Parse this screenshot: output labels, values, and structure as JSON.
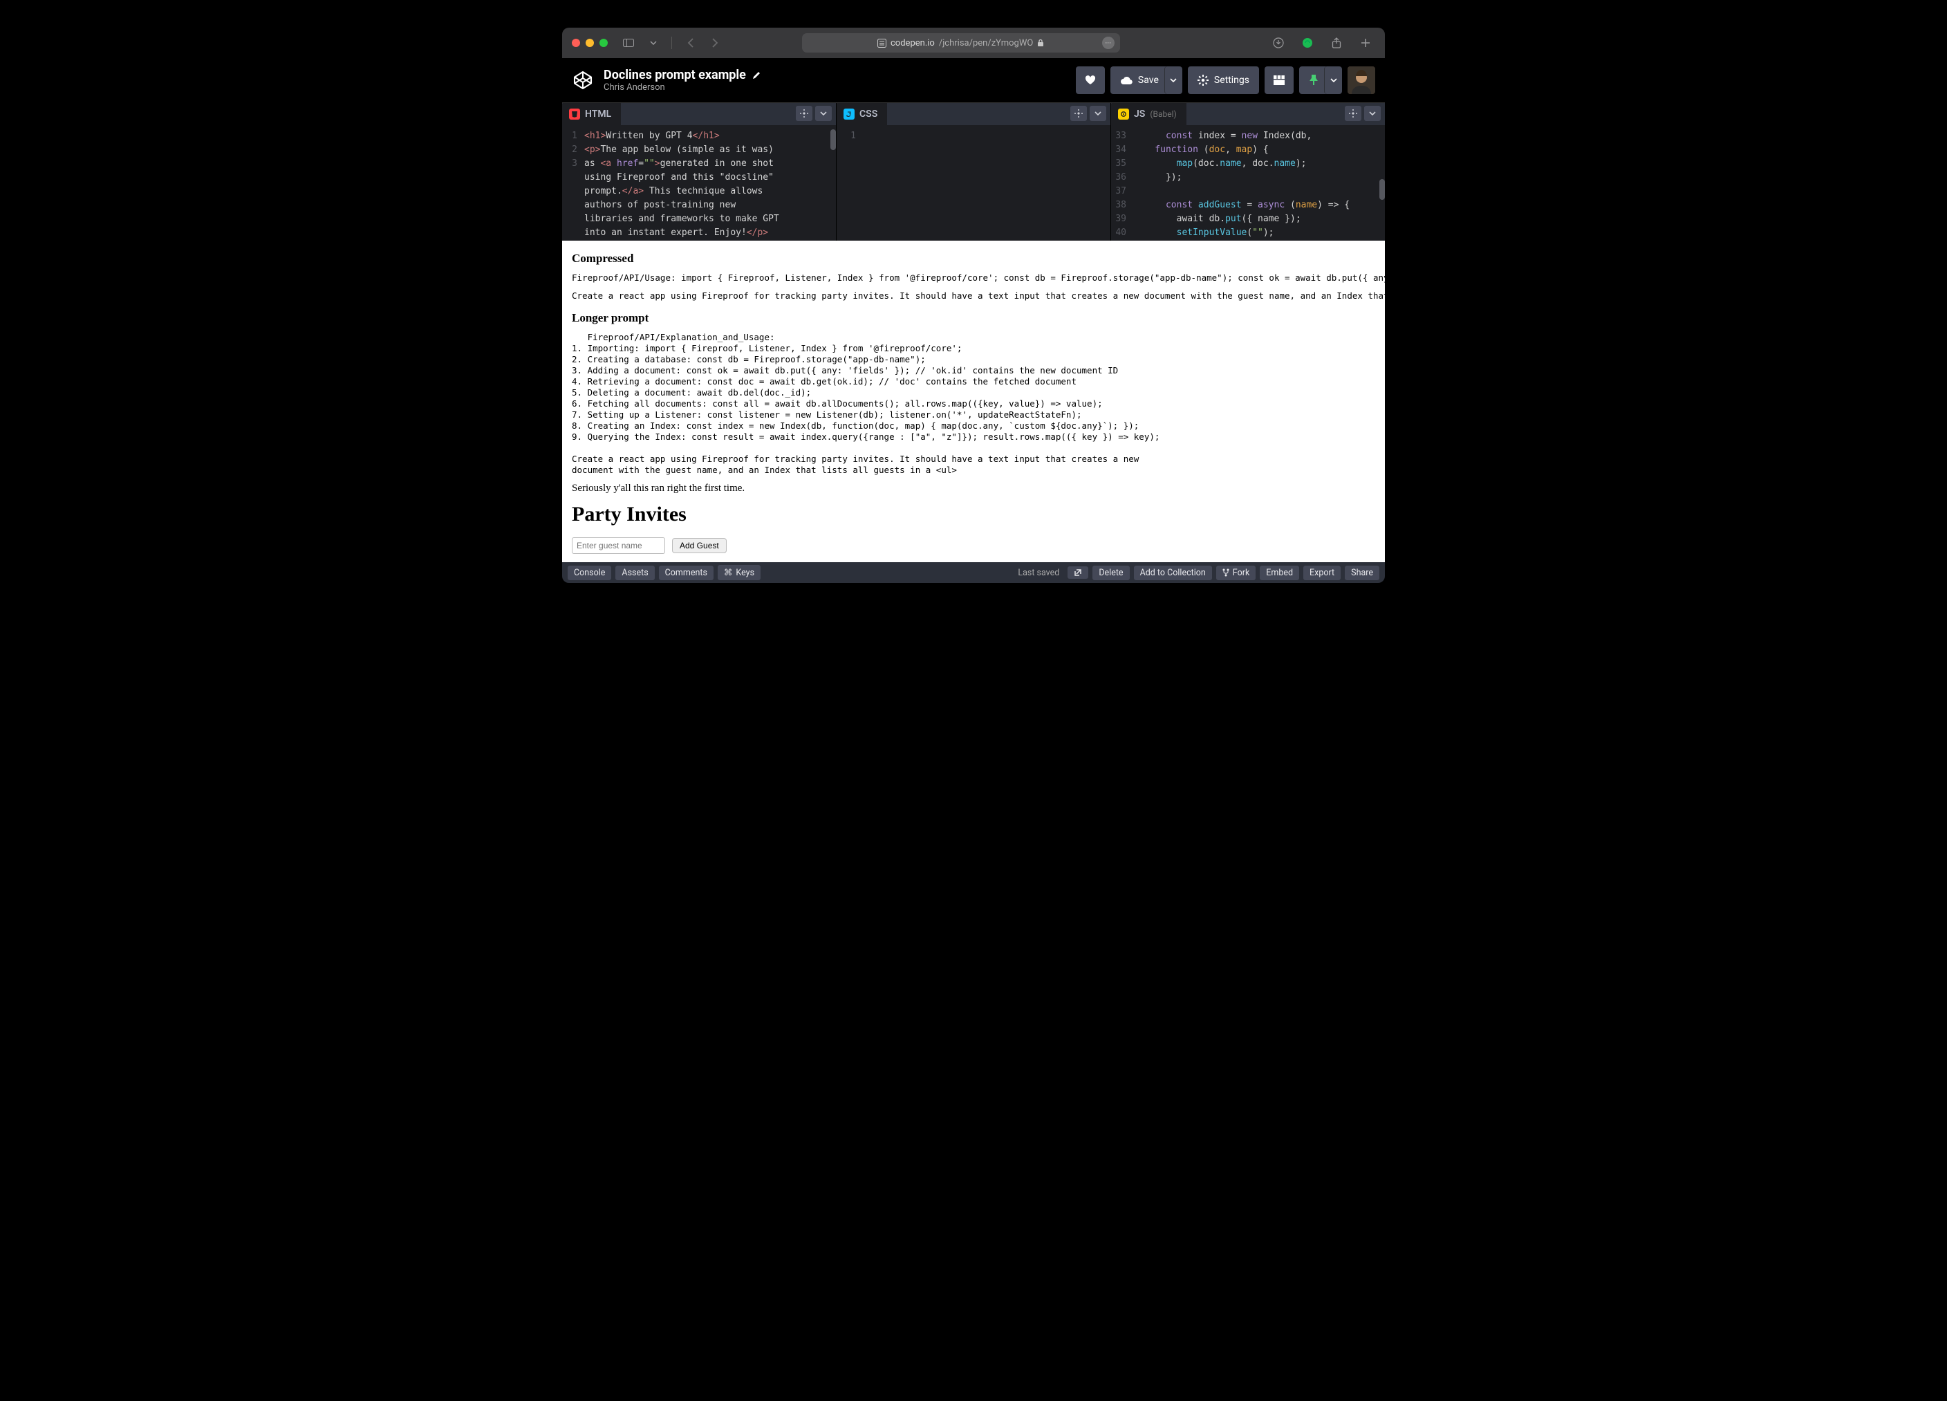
{
  "browser": {
    "url_host": "codepen.io",
    "url_path": "/jchrisa/pen/zYmogWO"
  },
  "header": {
    "title": "Doclines prompt example",
    "author": "Chris Anderson",
    "save_label": "Save",
    "settings_label": "Settings"
  },
  "panels": {
    "html": {
      "label": "HTML"
    },
    "css": {
      "label": "CSS"
    },
    "js": {
      "label": "JS",
      "sublabel": "(Babel)"
    }
  },
  "html_code": {
    "lines": [
      "1",
      "2",
      "",
      "",
      "",
      "",
      "",
      "",
      "3"
    ],
    "l1_open": "<h1>",
    "l1_text": "Written by GPT 4",
    "l1_close": "</h1>",
    "l2_open": "<p>",
    "l2a": "The app below (simple as it was)",
    "l2b_pre": "as ",
    "l2b_aopen": "<a ",
    "l2b_attr": "href",
    "l2b_eq": "=",
    "l2b_val": "\"\"",
    "l2b_aclose": ">",
    "l2b_text": "generated in one shot",
    "l2c": "using Fireproof and this \"docsline\"",
    "l2d_pre": "prompt.",
    "l2d_aclose": "</a>",
    "l2d_text": " This technique allows",
    "l2e": "authors of post-training new",
    "l2f": "libraries and frameworks to make GPT",
    "l2g_text": "into an instant expert. Enjoy!",
    "l2g_close": "</p>"
  },
  "css_code": {
    "line1": "1"
  },
  "js_code": {
    "lines": [
      "33",
      "34",
      "35",
      "36",
      "37",
      "38",
      "39",
      "40"
    ],
    "l33a": "      const ",
    "l33b": "index",
    "l33c": " = ",
    "l33d": "new",
    "l33e": " Index(db, ",
    "l33_cont": "    function",
    "l33_cont2": " (",
    "l33_cont3": "doc",
    "l33_cont4": ", ",
    "l33_cont5": "map",
    "l33_cont6": ") {",
    "l34a": "        ",
    "l34b": "map",
    "l34c": "(doc.",
    "l34d": "name",
    "l34e": ", doc.",
    "l34f": "name",
    "l34g": ");",
    "l35": "      });",
    "l37a": "      const ",
    "l37b": "addGuest",
    "l37c": " = ",
    "l37d": "async",
    "l37e": " (",
    "l37f": "name",
    "l37g": ") => {",
    "l38a": "        await db.",
    "l38b": "put",
    "l38c": "({ name });",
    "l39a": "        ",
    "l39b": "setInputValue",
    "l39c": "(",
    "l39d": "\"\"",
    "l39e": ");",
    "l40": "      };"
  },
  "preview": {
    "h_compressed": "Compressed",
    "compressed_line1": "Fireproof/API/Usage: import { Fireproof, Listener, Index } from '@fireproof/core'; const db = Fireproof.storage(\"app-db-name\"); const ok = await db.put({ any: 'fiel",
    "compressed_line2": "Create a react app using Fireproof for tracking party invites. It should have a text input that creates a new document with the guest name, and an Index that lists a",
    "h_longer": "Longer prompt",
    "longer_block": "   Fireproof/API/Explanation_and_Usage:\n1. Importing: import { Fireproof, Listener, Index } from '@fireproof/core';\n2. Creating a database: const db = Fireproof.storage(\"app-db-name\");\n3. Adding a document: const ok = await db.put({ any: 'fields' }); // 'ok.id' contains the new document ID\n4. Retrieving a document: const doc = await db.get(ok.id); // 'doc' contains the fetched document\n5. Deleting a document: await db.del(doc._id);\n6. Fetching all documents: const all = await db.allDocuments(); all.rows.map(({key, value}) => value);\n7. Setting up a Listener: const listener = new Listener(db); listener.on('*', updateReactStateFn);\n8. Creating an Index: const index = new Index(db, function(doc, map) { map(doc.any, `custom ${doc.any}`); });\n9. Querying the Index: const result = await index.query({range : [\"a\", \"z\"]}); result.rows.map(({ key }) => key);\n\nCreate a react app using Fireproof for tracking party invites. It should have a text input that creates a new\ndocument with the guest name, and an Index that lists all guests in a <ul>",
    "seriously": "Seriously y'all this ran right the first time.",
    "party_h1": "Party Invites",
    "guest_placeholder": "Enter guest name",
    "add_guest": "Add Guest"
  },
  "footer": {
    "console": "Console",
    "assets": "Assets",
    "comments": "Comments",
    "keys": "Keys",
    "last_saved": "Last saved",
    "delete": "Delete",
    "addcol": "Add to Collection",
    "fork": "Fork",
    "embed": "Embed",
    "export": "Export",
    "share": "Share"
  }
}
